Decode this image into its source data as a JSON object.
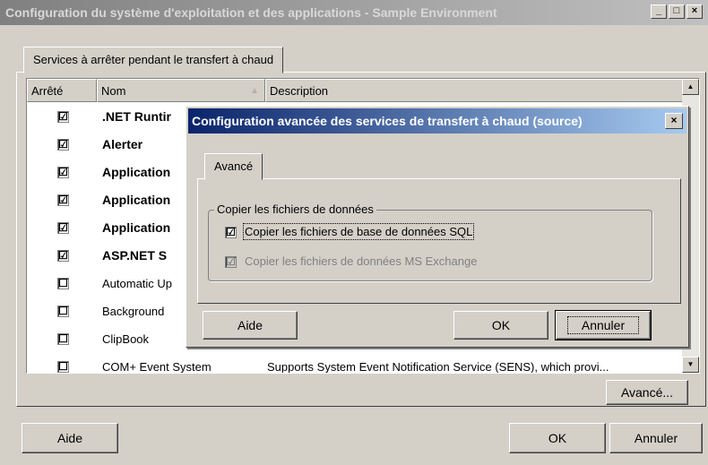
{
  "window": {
    "title": "Configuration du système d'exploitation et des applications - Sample Environment",
    "controls": [
      "_",
      "□",
      "×"
    ]
  },
  "main": {
    "tab_label": "Services à arrêter pendant le transfert à chaud",
    "columns": {
      "stopped": "Arrêté",
      "name": "Nom",
      "description": "Description"
    },
    "rows": [
      {
        "checked": "☑",
        "name": ".NET Runtir",
        "bold": true,
        "description": ""
      },
      {
        "checked": "☑",
        "name": "Alerter",
        "bold": true,
        "description": ""
      },
      {
        "checked": "☑",
        "name": "Application",
        "bold": true,
        "description": ""
      },
      {
        "checked": "☑",
        "name": "Application",
        "bold": true,
        "description": ""
      },
      {
        "checked": "☑",
        "name": "Application",
        "bold": true,
        "description": ""
      },
      {
        "checked": "☑",
        "name": "ASP.NET S",
        "bold": true,
        "description": ""
      },
      {
        "checked": "☐",
        "name": "Automatic Up",
        "bold": false,
        "description": ""
      },
      {
        "checked": "☐",
        "name": "Background",
        "bold": false,
        "description": ""
      },
      {
        "checked": "☐",
        "name": "ClipBook",
        "bold": false,
        "description": ""
      },
      {
        "checked": "☐",
        "name": "COM+ Event System",
        "bold": false,
        "description": "Supports System Event Notification Service (SENS), which provi..."
      }
    ],
    "advanced_button": "Avancé...",
    "help_button": "Aide",
    "ok_button": "OK",
    "cancel_button": "Annuler"
  },
  "dialog": {
    "title": "Configuration avancée des services de transfert à chaud (source)",
    "close": "×",
    "tab_label": "Avancé",
    "group_label": "Copier les fichiers de données",
    "option_sql": {
      "label": "Copier les fichiers de base de données SQL",
      "checked": "☑"
    },
    "option_exchange": {
      "label": "Copier les fichiers de données MS Exchange",
      "checked": "☑"
    },
    "help_button": "Aide",
    "ok_button": "OK",
    "cancel_button": "Annuler"
  },
  "colors": {
    "face": "#d4d0c8",
    "active_title": "#0a246a",
    "inactive_title": "#808080"
  }
}
